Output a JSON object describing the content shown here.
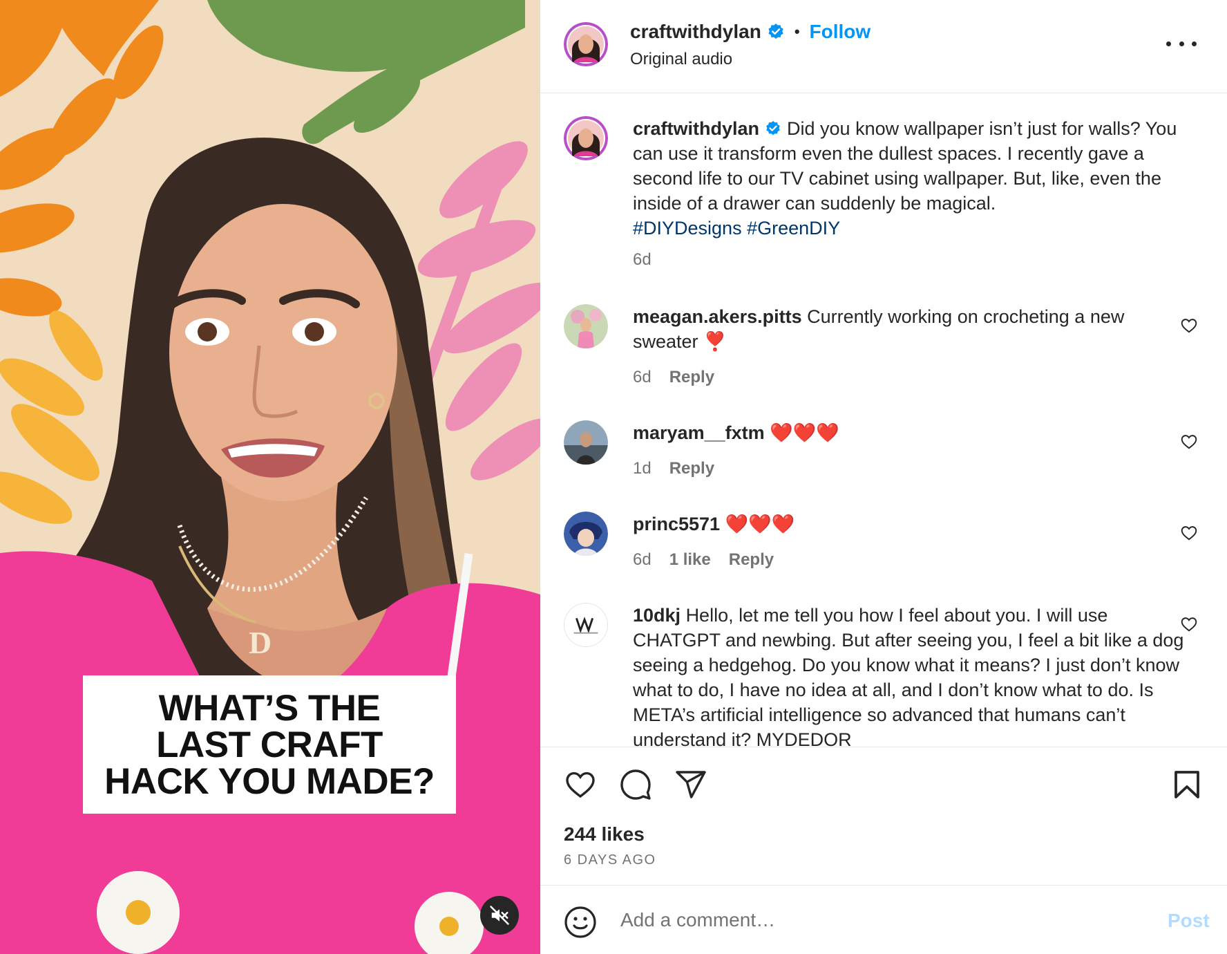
{
  "post": {
    "username": "craftwithdylan",
    "follow_label": "Follow",
    "separator": "•",
    "audio": "Original audio",
    "overlay_lines": [
      "WHAT’S THE",
      "LAST CRAFT",
      "HACK YOU MADE?"
    ]
  },
  "caption": {
    "username": "craftwithdylan",
    "text": "Did you know wallpaper isn’t just for walls? You can use it transform even the dullest spaces. I recently gave a second life to our TV cabinet using wallpaper. But, like, even the inside of a drawer can suddenly be magical.",
    "hashtags": "#DIYDesigns #GreenDIY",
    "time": "6d"
  },
  "comments": [
    {
      "username": "meagan.akers.pitts",
      "text": "Currently working on crocheting a new sweater ❣️",
      "time": "6d",
      "likes": "",
      "reply": "Reply"
    },
    {
      "username": "maryam__fxtm",
      "text": "❤️❤️❤️",
      "time": "1d",
      "likes": "",
      "reply": "Reply"
    },
    {
      "username": "princ5571",
      "text": "❤️❤️❤️",
      "time": "6d",
      "likes": "1 like",
      "reply": "Reply"
    },
    {
      "username": "10dkj",
      "text": "Hello, let me tell you how I feel about you. I will use CHATGPT and newbing. But after seeing you, I feel a bit like a dog seeing a hedgehog. Do you know what it means? I just don’t know what to do, I have no idea at all, and I don’t know what to do. Is META’s artificial intelligence so advanced that humans can’t understand it? MYDEDOR",
      "time": "",
      "likes": "",
      "reply": ""
    }
  ],
  "stats": {
    "likes": "244 likes",
    "posted": "6 DAYS AGO"
  },
  "composer": {
    "placeholder": "Add a comment…",
    "post_label": "Post"
  },
  "icons": {
    "more": "more-options-icon",
    "verified": "verified-badge-icon",
    "like": "heart-icon",
    "comment": "comment-icon",
    "share": "share-icon",
    "save": "bookmark-icon",
    "emoji": "emoji-icon",
    "mute": "muted-speaker-icon"
  },
  "colors": {
    "link": "#0095f6",
    "hashtag": "#00376b",
    "muted": "#737373",
    "text": "#262626",
    "post_disabled": "#b3dbff"
  }
}
